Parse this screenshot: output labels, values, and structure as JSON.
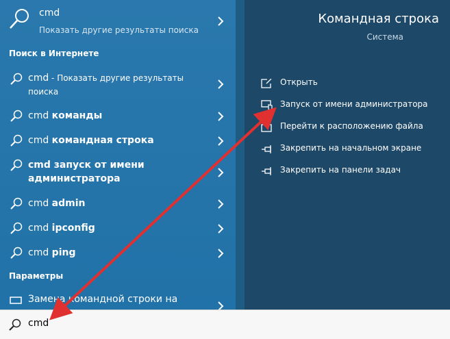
{
  "top_result": {
    "title": "cmd",
    "subtitle": "Показать другие результаты поиска"
  },
  "sections": {
    "web": "Поиск в Интернете",
    "settings": "Параметры"
  },
  "web_items": [
    {
      "prefix": "cmd",
      "bold": "",
      "rest": " - Показать другие результаты поиска"
    },
    {
      "prefix": "cmd ",
      "bold": "команды",
      "rest": ""
    },
    {
      "prefix": "cmd ",
      "bold": "командная строка",
      "rest": ""
    },
    {
      "prefix": "",
      "bold": "cmd запуск от имени администратора",
      "rest": ""
    },
    {
      "prefix": "cmd ",
      "bold": "admin",
      "rest": ""
    },
    {
      "prefix": "cmd ",
      "bold": "ipconfig",
      "rest": ""
    },
    {
      "prefix": "cmd ",
      "bold": "ping",
      "rest": ""
    }
  ],
  "settings_items": [
    {
      "label": "Замена командной строки на"
    }
  ],
  "right_panel": {
    "title": "Командная строка",
    "subtitle": "Система",
    "actions": [
      {
        "label": "Открыть",
        "icon": "open-icon"
      },
      {
        "label": "Запуск от имени администратора",
        "icon": "shield-icon"
      },
      {
        "label": "Перейти к расположению файла",
        "icon": "folder-icon"
      },
      {
        "label": "Закрепить на начальном экране",
        "icon": "pin-icon"
      },
      {
        "label": "Закрепить на панели задач",
        "icon": "pin-icon"
      }
    ]
  },
  "search": {
    "value": "cmd"
  },
  "colors": {
    "left_bg": "#2172a8",
    "right_bg": "#1d4868",
    "arrow": "#e03030"
  }
}
